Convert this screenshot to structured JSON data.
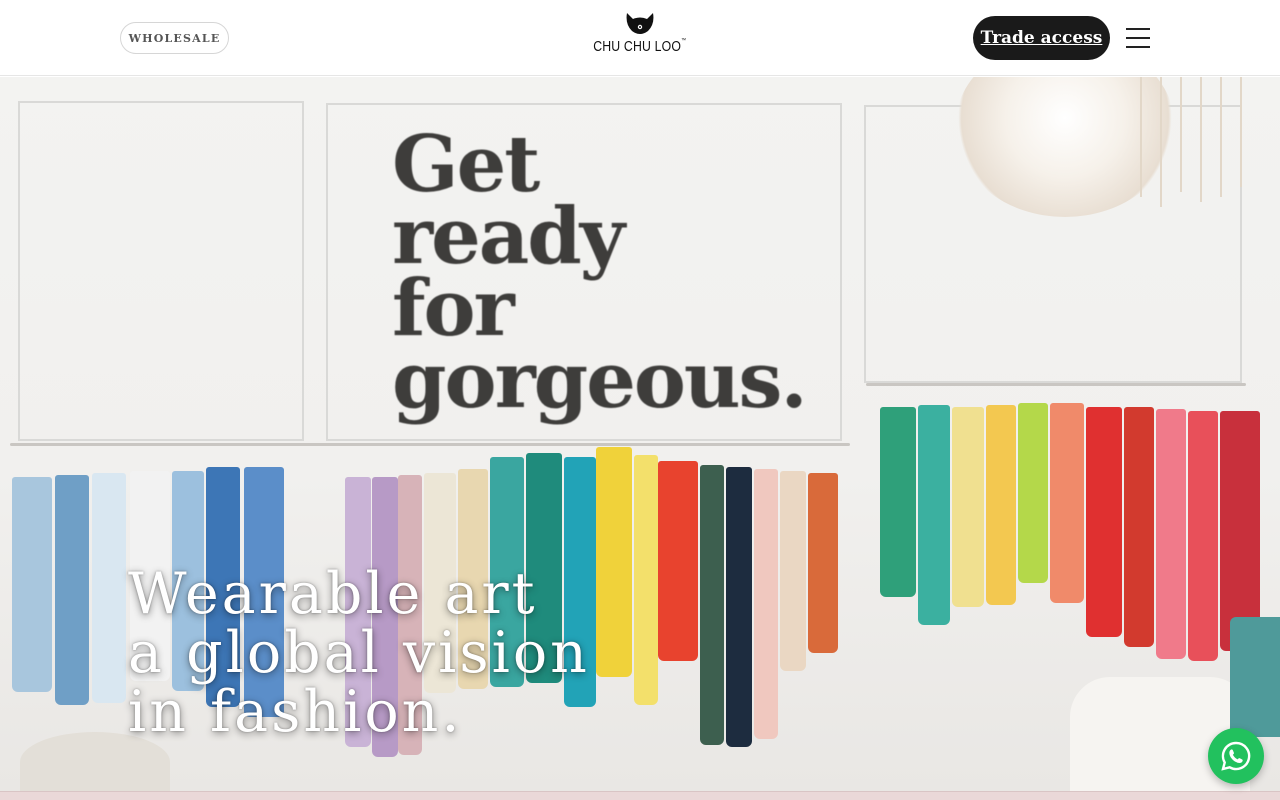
{
  "header": {
    "wholesale_label": "WHOLESALE",
    "logo_text": "CHU CHU LOO",
    "logo_tm": "™",
    "trade_access_label": "Trade access",
    "menu_icon": "hamburger-menu-icon"
  },
  "hero": {
    "wall_sign": [
      "Get",
      "ready",
      "for",
      "gorgeous."
    ],
    "headline": [
      "Wearable art",
      "a global vision",
      "in fashion."
    ]
  },
  "floating": {
    "whatsapp_icon": "whatsapp-icon",
    "whatsapp_color": "#22c15e"
  },
  "colors": {
    "header_bg": "#ffffff",
    "button_dark": "#1a1a1a",
    "bottom_strip": "#ead8d8"
  }
}
